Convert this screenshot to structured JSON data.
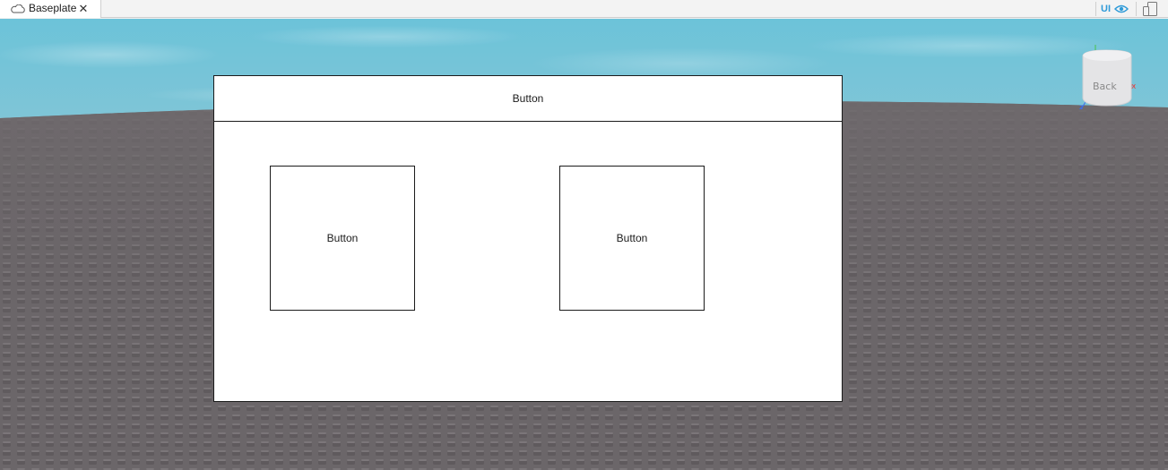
{
  "tab": {
    "title": "Baseplate",
    "cloud_icon": "cloud-icon",
    "close_symbol": "✕"
  },
  "toolbar": {
    "ui_label": "UI",
    "eye_icon": "eye-icon",
    "device_icon": "device-emulator-icon"
  },
  "viewport": {
    "gui": {
      "top_button_label": "Button",
      "left_button_label": "Button",
      "right_button_label": "Button"
    },
    "view_cube": {
      "face_label": "Back",
      "axis_x_label": "X",
      "axis_z_label": "Z"
    }
  },
  "colors": {
    "accent": "#2f9bd8",
    "sky_top": "#6cc3d9",
    "ground": "#6b6669"
  }
}
